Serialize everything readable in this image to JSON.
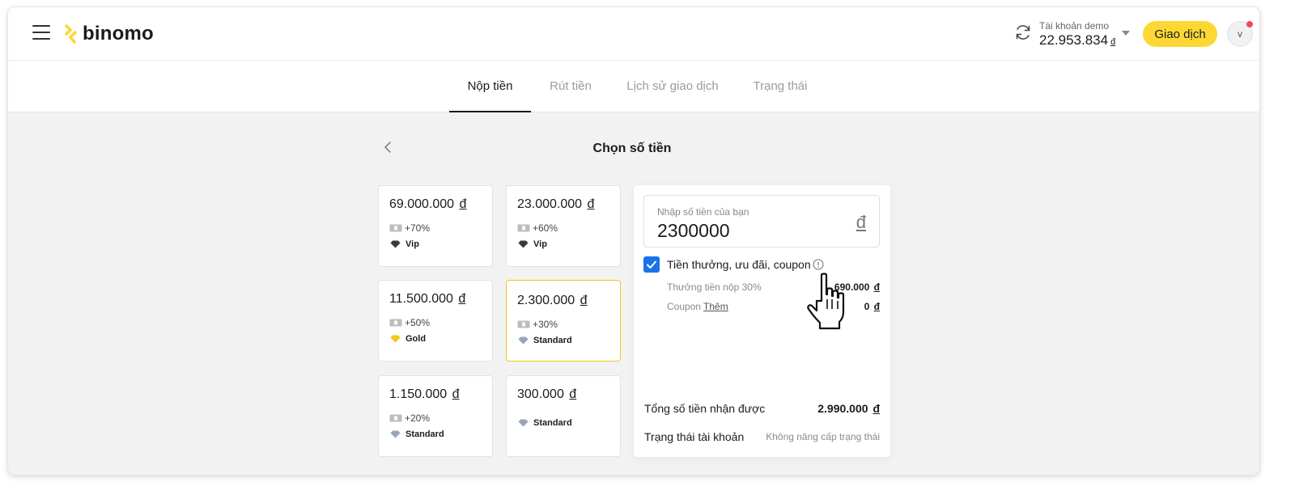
{
  "header": {
    "logo_text": "binomo",
    "account_label": "Tài khoản demo",
    "account_balance": "22.953.834",
    "currency": "đ",
    "trade_button": "Giao dịch",
    "avatar_initial": "v",
    "brand_color": "#fdd835"
  },
  "tabs": [
    {
      "label": "Nộp tiền",
      "active": true
    },
    {
      "label": "Rút tiền",
      "active": false
    },
    {
      "label": "Lịch sử giao dịch",
      "active": false
    },
    {
      "label": "Trạng thái",
      "active": false
    }
  ],
  "page": {
    "title": "Chọn số tiền"
  },
  "cards": [
    {
      "amount": "69.000.000",
      "currency": "đ",
      "bonus": "+70%",
      "tier": "Vip",
      "selected": false
    },
    {
      "amount": "23.000.000",
      "currency": "đ",
      "bonus": "+60%",
      "tier": "Vip",
      "selected": false
    },
    {
      "amount": "11.500.000",
      "currency": "đ",
      "bonus": "+50%",
      "tier": "Gold",
      "selected": false
    },
    {
      "amount": "2.300.000",
      "currency": "đ",
      "bonus": "+30%",
      "tier": "Standard",
      "selected": true
    },
    {
      "amount": "1.150.000",
      "currency": "đ",
      "bonus": "+20%",
      "tier": "Standard",
      "selected": false
    },
    {
      "amount": "300.000",
      "currency": "đ",
      "bonus": "",
      "tier": "Standard",
      "selected": false
    }
  ],
  "panel": {
    "input_label": "Nhập số tiền của bạn",
    "input_value": "2300000",
    "input_currency": "đ",
    "bonus_checkbox_label": "Tiền thưởng, ưu đãi, coupon",
    "bonus_checked": true,
    "deposit_bonus_label": "Thưởng tiền nộp 30%",
    "deposit_bonus_value": "690.000",
    "coupon_label": "Coupon",
    "coupon_link": "Thêm",
    "coupon_value": "0",
    "currency": "đ",
    "total_label": "Tổng số tiền nhận được",
    "total_value": "2.990.000",
    "status_label": "Trạng thái tài khoản",
    "status_value": "Không nâng cấp trạng thái"
  }
}
